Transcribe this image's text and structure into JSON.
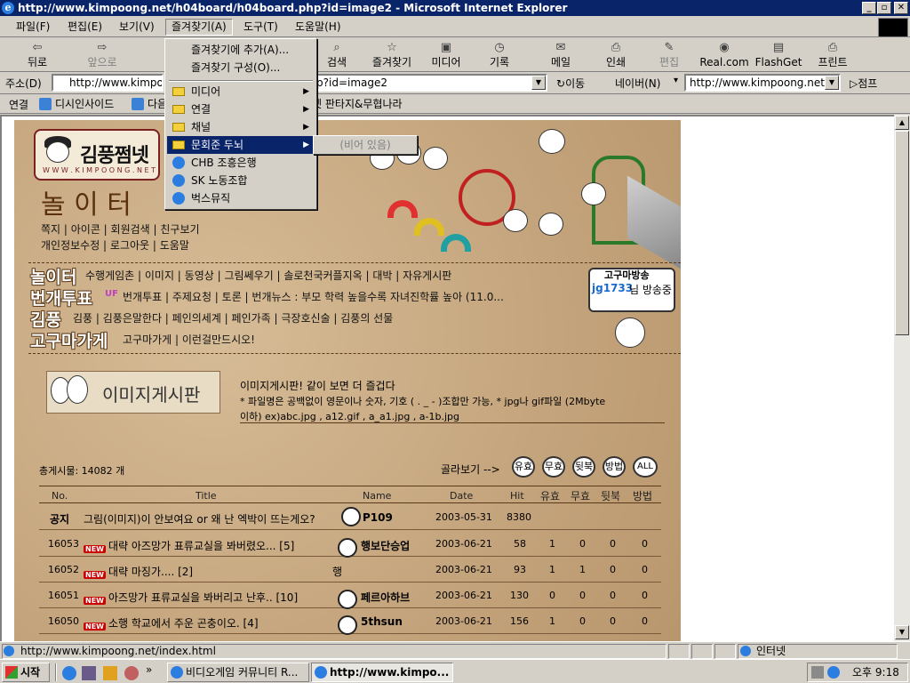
{
  "window": {
    "title": "http://www.kimpoong.net/h04board/h04board.php?id=image2 - Microsoft Internet Explorer"
  },
  "menubar": {
    "items": [
      {
        "label": "파일(F)"
      },
      {
        "label": "편집(E)"
      },
      {
        "label": "보기(V)"
      },
      {
        "label": "즐겨찾기(A)"
      },
      {
        "label": "도구(T)"
      },
      {
        "label": "도움말(H)"
      }
    ]
  },
  "toolbar": {
    "back": "뒤로",
    "forward": "앞으로",
    "search": "검색",
    "favorites": "즐겨찾기",
    "media": "미디어",
    "history": "기록",
    "mail": "메일",
    "print": "인쇄",
    "edit": "편집",
    "real": "Real.com",
    "flashget": "FlashGet",
    "printer": "프린트"
  },
  "addressbar": {
    "label": "주소(D)",
    "url_left": "http://www.kimpo",
    "url_right": "p?id=image2",
    "go": "이동",
    "naver_label": "네이버(N)",
    "naver_value": "http://www.kimpoong.net/",
    "jump": "점프"
  },
  "linksbar": {
    "label": "연결",
    "items": [
      {
        "label": "디시인사이드"
      },
      {
        "label": "다음"
      },
      {
        "label": "풍넷 판타지&무협나라"
      }
    ]
  },
  "favorites_menu": {
    "items": [
      {
        "label": "즐겨찾기에 추가(A)..."
      },
      {
        "label": "즐겨찾기 구성(O)..."
      },
      {
        "label": "미디어"
      },
      {
        "label": "연결"
      },
      {
        "label": "채널"
      },
      {
        "label": "문회준 두뇌"
      },
      {
        "label": "CHB 조흥은행"
      },
      {
        "label": "SK 노동조합"
      },
      {
        "label": "벅스뮤직"
      }
    ],
    "submenu_empty": "(비어 있음)"
  },
  "site": {
    "logo_text": "김풍쩜넷",
    "logo_url": "W W W . K I M P O O N G . N E T",
    "section_title": "놀 이 터",
    "user_links_1": "쪽지 | 아이콘 | 회원검색 | 친구보기",
    "user_links_2": "개인정보수정 | 로그아웃 | 도움말",
    "nav": [
      {
        "title": "놀이터",
        "links": "수행게임촌 | 이미지 | 동영상 | 그림쎄우기 | 솔로천국커플지옥 | 대박 | 자유게시판"
      },
      {
        "title": "번개투표",
        "links": "번개투표 | 주제요청 | 토론   | 번개뉴스 : 부모 학력 높을수록 자녀진학률 높아 (11.0..."
      },
      {
        "title": "김풍",
        "links": "김풍 | 김풍은말한다 | 페인의세계 | 페인가족 | 극장호신술 | 김풍의 선물"
      },
      {
        "title": "고구마가게",
        "links": "고구마가게 | 이런걸만드시오!"
      }
    ],
    "uf_badge": "UF",
    "broadcast_title": "고구마방송",
    "broadcast_user": "jg1733",
    "broadcast_suffix": "님 방송중",
    "board_title": "이미지게시판",
    "board_desc_1": "이미지게시판! 같이 보면 더 즐겁다",
    "board_desc_2": "* 파일명은 공백없이 영문이나 숫자, 기호 ( . _ - )조합만 가능, * jpg나 gif파일 (2Mbyte",
    "board_desc_3": "이하) ex)abc.jpg , a12.gif , a_a1.jpg , a-1b.jpg",
    "total_posts": "총게시물: 14082 개",
    "filter_label": "골라보기 -->",
    "filters": [
      "유효",
      "무효",
      "뒷북",
      "방법",
      "ALL"
    ]
  },
  "board": {
    "headers": [
      "No.",
      "Title",
      "Name",
      "Date",
      "Hit",
      "유효",
      "무효",
      "뒷북",
      "방법"
    ],
    "new_badge": "NEW",
    "rows": [
      {
        "no": "공지",
        "title": "그림(이미지)이 안보여요 or 왜 난 엑박이 뜨는게오?",
        "name": "P109",
        "date": "2003-05-31",
        "hit": "8380",
        "v1": "",
        "v2": "",
        "v3": "",
        "v4": ""
      },
      {
        "no": "16053",
        "title": "대략 아즈망가 표류교실을 봐버렸오... [5]",
        "name": "행보단승업",
        "date": "2003-06-21",
        "hit": "58",
        "v1": "1",
        "v2": "0",
        "v3": "0",
        "v4": "0"
      },
      {
        "no": "16052",
        "title": "대략 마징가.... [2]",
        "name": "행",
        "date": "2003-06-21",
        "hit": "93",
        "v1": "1",
        "v2": "1",
        "v3": "0",
        "v4": "0"
      },
      {
        "no": "16051",
        "title": "아즈망가 표류교실을 봐버리고 난후.. [10]",
        "name": "페르아하브",
        "date": "2003-06-21",
        "hit": "130",
        "v1": "0",
        "v2": "0",
        "v3": "0",
        "v4": "0"
      },
      {
        "no": "16050",
        "title": "소행 학교에서 주운 곤충이오. [4]",
        "name": "5thsun",
        "date": "2003-06-21",
        "hit": "156",
        "v1": "1",
        "v2": "0",
        "v3": "0",
        "v4": "0"
      }
    ]
  },
  "statusbar": {
    "url": "http://www.kimpoong.net/index.html",
    "zone": "인터넷"
  },
  "taskbar": {
    "start": "시작",
    "tasks": [
      {
        "label": "비디오게임 커뮤니티 R..."
      },
      {
        "label": "http://www.kimpo..."
      }
    ],
    "clock": "오후 9:18"
  }
}
